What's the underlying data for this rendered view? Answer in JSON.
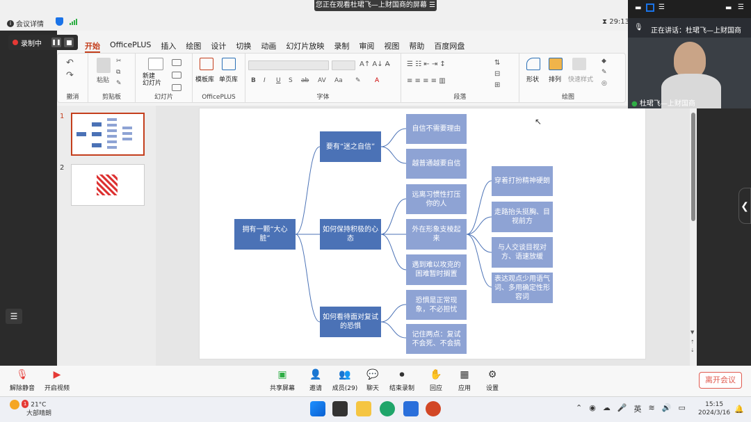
{
  "meeting": {
    "share_banner": "您正在观看杜珺飞—上财国商的屏幕",
    "details_label": "会议详情",
    "timer": "29:13",
    "rec_label": "录制中",
    "speaking_now": "正在讲话：杜珺飞—上财国商",
    "participant_name": "杜珺飞—上财国商"
  },
  "ppt": {
    "tabs": [
      "开始",
      "OfficePLUS",
      "插入",
      "绘图",
      "设计",
      "切换",
      "动画",
      "幻灯片放映",
      "录制",
      "审阅",
      "视图",
      "帮助",
      "百度网盘"
    ],
    "active_tab": "开始",
    "groups": {
      "undo": "撤消",
      "clipboard": "剪贴板",
      "paste": "粘贴",
      "slides": "幻灯片",
      "new_slide": "新建\n幻灯片",
      "officeplus": "OfficePLUS",
      "template_lib": "模板库",
      "single_page": "单页库",
      "font": "字体",
      "paragraph": "段落",
      "drawing": "绘图",
      "shape": "形状",
      "arrange": "排列",
      "quick_style": "快速样式"
    },
    "font_buttons": [
      "B",
      "I",
      "U",
      "S",
      "ab",
      "AV",
      "Aa",
      "A"
    ],
    "thumb_numbers": [
      "1",
      "2"
    ]
  },
  "mindmap": {
    "root": "拥有一颗“大心脏”",
    "branches": [
      {
        "label": "要有“迷之自信”",
        "children": [
          "自信不需要理由",
          "越普通越要自信"
        ]
      },
      {
        "label": "如何保持积极的心态",
        "children": [
          "远离习惯性打压你的人",
          "外在形象支棱起来",
          "遇到难以攻克的困难暂时搁置"
        ]
      },
      {
        "label": "如何看待面对复试的恐惧",
        "children": [
          "恐惧是正常现象，不必担忧",
          "记住两点：复试不会死、不会搞"
        ]
      }
    ],
    "sub": [
      "穿着打扮精神硬朗",
      "走路抬头挺胸、目视前方",
      "与人交谈目视对方、语速放缓",
      "表达观点少用语气词、多用确定性形容词"
    ]
  },
  "controls": {
    "unmute": "解除静音",
    "video": "开启视频",
    "share": "共享屏幕",
    "invite": "邀请",
    "members": "成员(29)",
    "chat": "聊天",
    "end_record": "结束录制",
    "react": "回应",
    "apps": "应用",
    "settings": "设置",
    "leave": "离开会议"
  },
  "taskbar": {
    "temp": "21°C",
    "weather": "大部晴朗",
    "badge": "1",
    "ime": "英",
    "time": "15:15",
    "date": "2024/3/16"
  }
}
